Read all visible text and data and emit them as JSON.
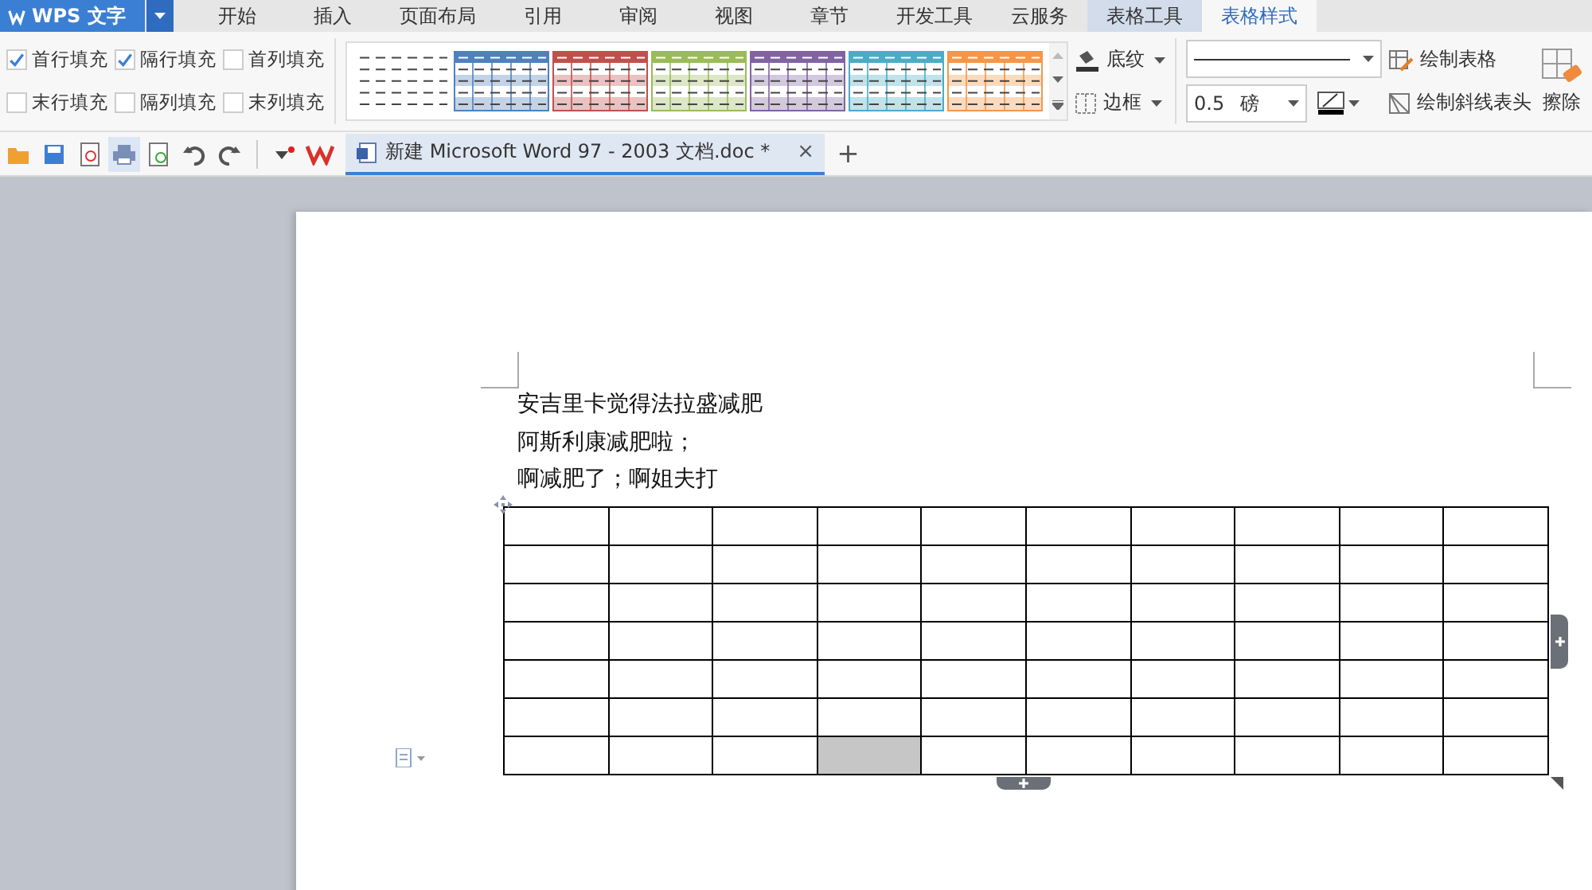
{
  "app_button": {
    "label": "WPS 文字"
  },
  "menu_tabs": [
    {
      "label": "开始",
      "selected": false,
      "highlighted": false
    },
    {
      "label": "插入",
      "selected": false,
      "highlighted": false
    },
    {
      "label": "页面布局",
      "selected": false,
      "highlighted": false
    },
    {
      "label": "引用",
      "selected": false,
      "highlighted": false
    },
    {
      "label": "审阅",
      "selected": false,
      "highlighted": false
    },
    {
      "label": "视图",
      "selected": false,
      "highlighted": false
    },
    {
      "label": "章节",
      "selected": false,
      "highlighted": false
    },
    {
      "label": "开发工具",
      "selected": false,
      "highlighted": false
    },
    {
      "label": "云服务",
      "selected": false,
      "highlighted": false
    },
    {
      "label": "表格工具",
      "selected": false,
      "highlighted": true
    },
    {
      "label": "表格样式",
      "selected": true,
      "highlighted": false
    }
  ],
  "fill_options": [
    {
      "label": "首行填充",
      "checked": true
    },
    {
      "label": "隔行填充",
      "checked": true
    },
    {
      "label": "首列填充",
      "checked": false
    },
    {
      "label": "末行填充",
      "checked": false
    },
    {
      "label": "隔列填充",
      "checked": false
    },
    {
      "label": "末列填充",
      "checked": false
    }
  ],
  "table_styles": [
    {
      "kind": "plain"
    },
    {
      "kind": "colored",
      "color": "#4f81bd"
    },
    {
      "kind": "colored",
      "color": "#c0504d"
    },
    {
      "kind": "colored",
      "color": "#9bbb59"
    },
    {
      "kind": "colored",
      "color": "#8064a2"
    },
    {
      "kind": "colored",
      "color": "#4bacc6"
    },
    {
      "kind": "colored",
      "color": "#f79646"
    }
  ],
  "shading_button": {
    "label": "底纹"
  },
  "border_button": {
    "label": "边框"
  },
  "line_width": {
    "value": "0.5",
    "unit": "磅"
  },
  "draw_table_button": {
    "label": "绘制表格"
  },
  "draw_diagonal_button": {
    "label": "绘制斜线表头"
  },
  "erase_button": {
    "label": "擦除"
  },
  "document_tab": {
    "title": "新建 Microsoft Word 97 - 2003 文档.doc *",
    "close": "×",
    "new": "+"
  },
  "paragraphs": [
    "安吉里卡觉得法拉盛减肥",
    "阿斯利康减肥啦；",
    "啊减肥了；啊姐夫打"
  ],
  "table": {
    "rows": [
      {
        "cells": [
          {
            "shaded": false
          },
          {
            "shaded": false
          },
          {
            "shaded": false
          },
          {
            "shaded": false
          },
          {
            "shaded": false
          },
          {
            "shaded": false
          },
          {
            "shaded": false
          },
          {
            "shaded": false
          },
          {
            "shaded": false
          },
          {
            "shaded": false
          }
        ]
      },
      {
        "cells": [
          {
            "shaded": false
          },
          {
            "shaded": false
          },
          {
            "shaded": false
          },
          {
            "shaded": false
          },
          {
            "shaded": false
          },
          {
            "shaded": false
          },
          {
            "shaded": false
          },
          {
            "shaded": false
          },
          {
            "shaded": false
          },
          {
            "shaded": false
          }
        ]
      },
      {
        "cells": [
          {
            "shaded": false
          },
          {
            "shaded": false
          },
          {
            "shaded": false
          },
          {
            "shaded": false
          },
          {
            "shaded": false
          },
          {
            "shaded": false
          },
          {
            "shaded": false
          },
          {
            "shaded": false
          },
          {
            "shaded": false
          },
          {
            "shaded": false
          }
        ]
      },
      {
        "cells": [
          {
            "shaded": false
          },
          {
            "shaded": false
          },
          {
            "shaded": false
          },
          {
            "shaded": false
          },
          {
            "shaded": false
          },
          {
            "shaded": false
          },
          {
            "shaded": false
          },
          {
            "shaded": false
          },
          {
            "shaded": false
          },
          {
            "shaded": false
          }
        ]
      },
      {
        "cells": [
          {
            "shaded": false
          },
          {
            "shaded": false
          },
          {
            "shaded": false
          },
          {
            "shaded": false
          },
          {
            "shaded": false
          },
          {
            "shaded": false
          },
          {
            "shaded": false
          },
          {
            "shaded": false
          },
          {
            "shaded": false
          },
          {
            "shaded": false
          }
        ]
      },
      {
        "cells": [
          {
            "shaded": false
          },
          {
            "shaded": false
          },
          {
            "shaded": false
          },
          {
            "shaded": false
          },
          {
            "shaded": false
          },
          {
            "shaded": false
          },
          {
            "shaded": false
          },
          {
            "shaded": false
          },
          {
            "shaded": false
          },
          {
            "shaded": false
          }
        ]
      },
      {
        "cells": [
          {
            "shaded": false
          },
          {
            "shaded": false
          },
          {
            "shaded": false
          },
          {
            "shaded": true
          },
          {
            "shaded": false
          },
          {
            "shaded": false
          },
          {
            "shaded": false
          },
          {
            "shaded": false
          },
          {
            "shaded": false
          },
          {
            "shaded": false
          }
        ]
      }
    ]
  }
}
